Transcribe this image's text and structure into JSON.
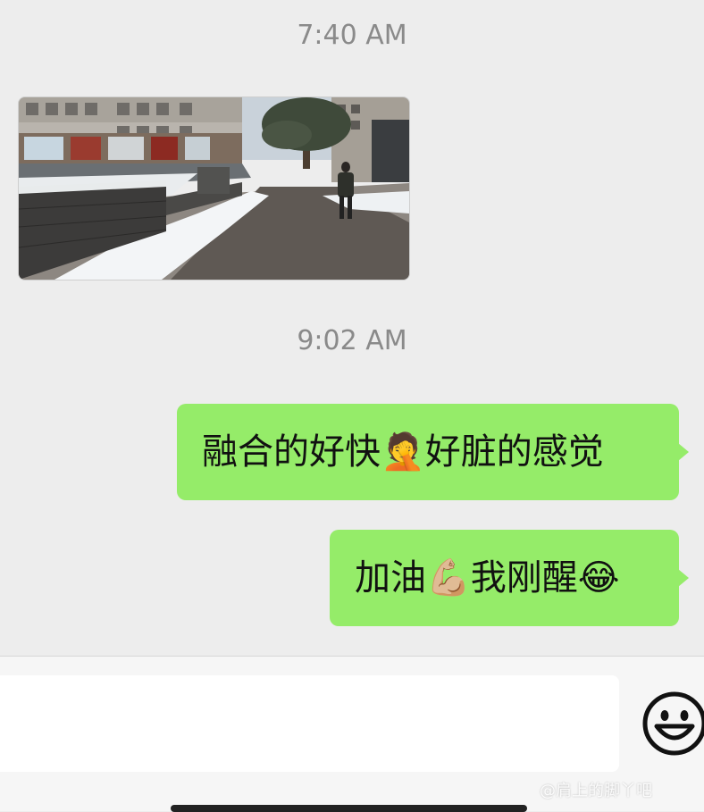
{
  "chat": {
    "timestamps": [
      "7:40 AM",
      "9:02 AM"
    ],
    "messages": [
      {
        "type": "image",
        "side": "left"
      },
      {
        "type": "text",
        "side": "right",
        "text": "融合的好快🤦好脏的感觉"
      },
      {
        "type": "text",
        "side": "right",
        "text": "加油💪🏼我刚醒😂"
      }
    ]
  },
  "input_bar": {
    "value": "",
    "emoji_icon": "smiley-icon"
  },
  "watermark": "@肩上的脚丫吧",
  "colors": {
    "background": "#ededed",
    "bubble_green": "#95ec69",
    "timestamp_text": "#8a8a8a"
  }
}
